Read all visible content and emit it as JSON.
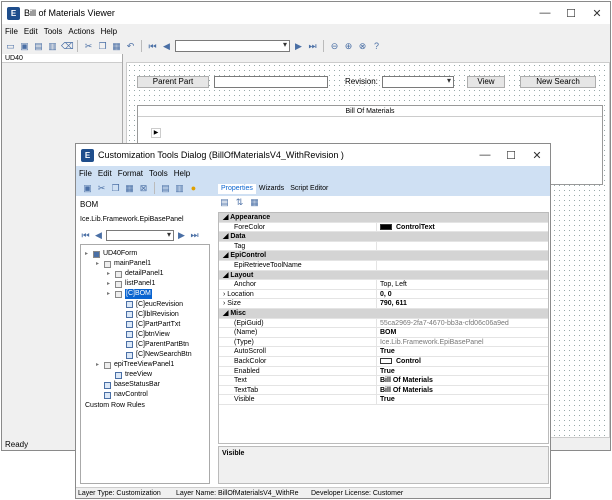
{
  "main": {
    "title": "Bill of Materials Viewer",
    "menu": [
      "File",
      "Edit",
      "Tools",
      "Actions",
      "Help"
    ],
    "tree_header": "UD40",
    "status": "Ready",
    "part_button": "Parent Part",
    "revision_label": "Revision:",
    "view_button": "View",
    "new_search_button": "New Search",
    "grid_title": "Bill Of Materials"
  },
  "dialog": {
    "title": "Customization Tools Dialog  (BillOfMaterialsV4_WithRevision )",
    "menu": [
      "File",
      "Edit",
      "Format",
      "Tools",
      "Help"
    ],
    "tabs": [
      "Properties",
      "Wizards",
      "Script Editor"
    ],
    "selected_name": "BOM",
    "selected_type": "Ice.Lib.Framework.EpiBasePanel",
    "tree": [
      {
        "label": "UD40Form",
        "indent": 0,
        "kind": "form"
      },
      {
        "label": "mainPanel1",
        "indent": 1,
        "kind": "box"
      },
      {
        "label": "detailPanel1",
        "indent": 2,
        "kind": "box"
      },
      {
        "label": "listPanel1",
        "indent": 2,
        "kind": "box"
      },
      {
        "label": "[C]BOM",
        "indent": 2,
        "kind": "box",
        "selected": true
      },
      {
        "label": "[C]eucRevision",
        "indent": 3,
        "kind": "ctl"
      },
      {
        "label": "[C]lblRevision",
        "indent": 3,
        "kind": "ctl"
      },
      {
        "label": "[C]PartPartTxt",
        "indent": 3,
        "kind": "ctl"
      },
      {
        "label": "[C]btnView",
        "indent": 3,
        "kind": "ctl"
      },
      {
        "label": "[C]ParentPartBtn",
        "indent": 3,
        "kind": "ctl"
      },
      {
        "label": "[C]NewSearchBtn",
        "indent": 3,
        "kind": "ctl"
      },
      {
        "label": "epiTreeViewPanel1",
        "indent": 1,
        "kind": "box"
      },
      {
        "label": "treeView",
        "indent": 2,
        "kind": "ctl"
      },
      {
        "label": "baseStatusBar",
        "indent": 1,
        "kind": "ctl"
      },
      {
        "label": "navControl",
        "indent": 1,
        "kind": "ctl"
      },
      {
        "label": "Custom Row Rules",
        "indent": 0,
        "kind": "none"
      }
    ],
    "properties": [
      {
        "name": "Appearance",
        "category": true
      },
      {
        "name": "ForeColor",
        "value": "ControlText",
        "bold": true,
        "swatch": "#000000"
      },
      {
        "name": "Data",
        "category": true
      },
      {
        "name": "Tag",
        "value": ""
      },
      {
        "name": "EpiControl",
        "category": true
      },
      {
        "name": "EpiRetrieveToolName",
        "value": ""
      },
      {
        "name": "Layout",
        "category": true
      },
      {
        "name": "Anchor",
        "value": "Top, Left"
      },
      {
        "name": "Location",
        "value": "0, 0",
        "bold": true,
        "expand": true
      },
      {
        "name": "Size",
        "value": "790, 611",
        "bold": true,
        "expand": true
      },
      {
        "name": "Misc",
        "category": true
      },
      {
        "name": "(EpiGuid)",
        "value": "55ca2969-2fa7-4670-bb3a-cfd06c06a9ed",
        "grey": true
      },
      {
        "name": "(Name)",
        "value": "BOM",
        "bold": true
      },
      {
        "name": "(Type)",
        "value": "Ice.Lib.Framework.EpiBasePanel",
        "grey": true
      },
      {
        "name": "AutoScroll",
        "value": "True",
        "bold": true
      },
      {
        "name": "BackColor",
        "value": "Control",
        "bold": true,
        "swatch": "#ffffff"
      },
      {
        "name": "Enabled",
        "value": "True",
        "bold": true
      },
      {
        "name": "Text",
        "value": "Bill Of Materials",
        "bold": true
      },
      {
        "name": "TextTab",
        "value": "Bill Of Materials",
        "bold": true
      },
      {
        "name": "Visible",
        "value": "True",
        "bold": true
      }
    ],
    "description": "Visible",
    "status": {
      "layer_type": "Layer Type:  Customization",
      "layer_name": "Layer Name:  BillOfMaterialsV4_WithRe",
      "license": "Developer License:  Customer"
    }
  },
  "colors": {
    "accent": "#1f4e8c",
    "panel": "#cfe0f3",
    "selected": "#0a64d0"
  }
}
